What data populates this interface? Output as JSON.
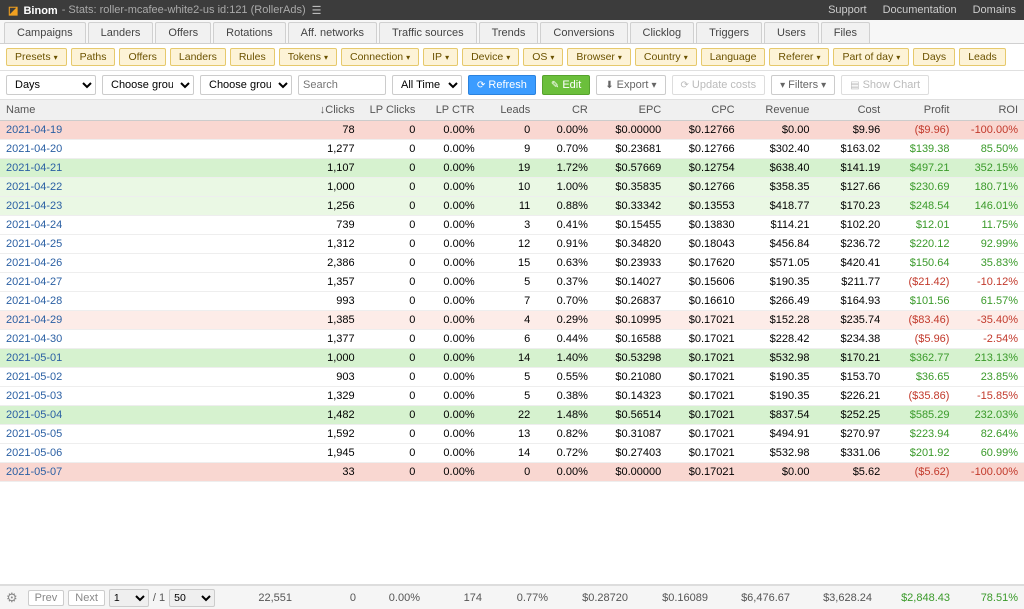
{
  "topbar": {
    "brand": "Binom",
    "title": "- Stats: roller-mcafee-white2-us id:121 (RollerAds)",
    "support": "Support",
    "documentation": "Documentation",
    "domains": "Domains"
  },
  "main_tabs": [
    "Campaigns",
    "Landers",
    "Offers",
    "Rotations",
    "Aff. networks",
    "Traffic sources",
    "Trends",
    "Conversions",
    "Clicklog",
    "Triggers",
    "Users",
    "Files"
  ],
  "pills": [
    {
      "label": "Presets",
      "caret": true
    },
    {
      "label": "Paths"
    },
    {
      "label": "Offers"
    },
    {
      "label": "Landers"
    },
    {
      "label": "Rules"
    },
    {
      "label": "Tokens",
      "caret": true
    },
    {
      "label": "Connection",
      "caret": true
    },
    {
      "label": "IP",
      "caret": true
    },
    {
      "label": "Device",
      "caret": true
    },
    {
      "label": "OS",
      "caret": true
    },
    {
      "label": "Browser",
      "caret": true
    },
    {
      "label": "Country",
      "caret": true
    },
    {
      "label": "Language"
    },
    {
      "label": "Referer",
      "caret": true
    },
    {
      "label": "Part of day",
      "caret": true
    },
    {
      "label": "Days"
    },
    {
      "label": "Leads"
    }
  ],
  "controls": {
    "group_days": "Days",
    "choose_grouping": "Choose grouping",
    "search_placeholder": "Search",
    "time_range": "All Time",
    "refresh": "Refresh",
    "edit": "Edit",
    "export": "Export",
    "update_costs": "Update costs",
    "filters": "Filters",
    "show_chart": "Show Chart"
  },
  "table": {
    "headers": {
      "name": "Name",
      "clicks": "Clicks",
      "clicks_sort": "↓",
      "lp_clicks": "LP Clicks",
      "lp_ctr": "LP CTR",
      "leads": "Leads",
      "cr": "CR",
      "epc": "EPC",
      "cpc": "CPC",
      "revenue": "Revenue",
      "cost": "Cost",
      "profit": "Profit",
      "roi": "ROI"
    },
    "rows": [
      {
        "name": "2021-04-19",
        "clicks": "78",
        "lp_clicks": "0",
        "lp_ctr": "0.00%",
        "leads": "0",
        "cr": "0.00%",
        "epc": "$0.00000",
        "cpc": "$0.12766",
        "revenue": "$0.00",
        "cost": "$9.96",
        "profit": "($9.96)",
        "roi": "-100.00%",
        "profit_neg": true,
        "roi_neg": true,
        "tone": "red"
      },
      {
        "name": "2021-04-20",
        "clicks": "1,277",
        "lp_clicks": "0",
        "lp_ctr": "0.00%",
        "leads": "9",
        "cr": "0.70%",
        "epc": "$0.23681",
        "cpc": "$0.12766",
        "revenue": "$302.40",
        "cost": "$163.02",
        "profit": "$139.38",
        "roi": "85.50%",
        "profit_neg": false,
        "roi_neg": false,
        "tone": ""
      },
      {
        "name": "2021-04-21",
        "clicks": "1,107",
        "lp_clicks": "0",
        "lp_ctr": "0.00%",
        "leads": "19",
        "cr": "1.72%",
        "epc": "$0.57669",
        "cpc": "$0.12754",
        "revenue": "$638.40",
        "cost": "$141.19",
        "profit": "$497.21",
        "roi": "352.15%",
        "profit_neg": false,
        "roi_neg": false,
        "tone": "green"
      },
      {
        "name": "2021-04-22",
        "clicks": "1,000",
        "lp_clicks": "0",
        "lp_ctr": "0.00%",
        "leads": "10",
        "cr": "1.00%",
        "epc": "$0.35835",
        "cpc": "$0.12766",
        "revenue": "$358.35",
        "cost": "$127.66",
        "profit": "$230.69",
        "roi": "180.71%",
        "profit_neg": false,
        "roi_neg": false,
        "tone": "ltgr"
      },
      {
        "name": "2021-04-23",
        "clicks": "1,256",
        "lp_clicks": "0",
        "lp_ctr": "0.00%",
        "leads": "11",
        "cr": "0.88%",
        "epc": "$0.33342",
        "cpc": "$0.13553",
        "revenue": "$418.77",
        "cost": "$170.23",
        "profit": "$248.54",
        "roi": "146.01%",
        "profit_neg": false,
        "roi_neg": false,
        "tone": "ltgr"
      },
      {
        "name": "2021-04-24",
        "clicks": "739",
        "lp_clicks": "0",
        "lp_ctr": "0.00%",
        "leads": "3",
        "cr": "0.41%",
        "epc": "$0.15455",
        "cpc": "$0.13830",
        "revenue": "$114.21",
        "cost": "$102.20",
        "profit": "$12.01",
        "roi": "11.75%",
        "profit_neg": false,
        "roi_neg": false,
        "tone": ""
      },
      {
        "name": "2021-04-25",
        "clicks": "1,312",
        "lp_clicks": "0",
        "lp_ctr": "0.00%",
        "leads": "12",
        "cr": "0.91%",
        "epc": "$0.34820",
        "cpc": "$0.18043",
        "revenue": "$456.84",
        "cost": "$236.72",
        "profit": "$220.12",
        "roi": "92.99%",
        "profit_neg": false,
        "roi_neg": false,
        "tone": ""
      },
      {
        "name": "2021-04-26",
        "clicks": "2,386",
        "lp_clicks": "0",
        "lp_ctr": "0.00%",
        "leads": "15",
        "cr": "0.63%",
        "epc": "$0.23933",
        "cpc": "$0.17620",
        "revenue": "$571.05",
        "cost": "$420.41",
        "profit": "$150.64",
        "roi": "35.83%",
        "profit_neg": false,
        "roi_neg": false,
        "tone": ""
      },
      {
        "name": "2021-04-27",
        "clicks": "1,357",
        "lp_clicks": "0",
        "lp_ctr": "0.00%",
        "leads": "5",
        "cr": "0.37%",
        "epc": "$0.14027",
        "cpc": "$0.15606",
        "revenue": "$190.35",
        "cost": "$211.77",
        "profit": "($21.42)",
        "roi": "-10.12%",
        "profit_neg": true,
        "roi_neg": true,
        "tone": ""
      },
      {
        "name": "2021-04-28",
        "clicks": "993",
        "lp_clicks": "0",
        "lp_ctr": "0.00%",
        "leads": "7",
        "cr": "0.70%",
        "epc": "$0.26837",
        "cpc": "$0.16610",
        "revenue": "$266.49",
        "cost": "$164.93",
        "profit": "$101.56",
        "roi": "61.57%",
        "profit_neg": false,
        "roi_neg": false,
        "tone": ""
      },
      {
        "name": "2021-04-29",
        "clicks": "1,385",
        "lp_clicks": "0",
        "lp_ctr": "0.00%",
        "leads": "4",
        "cr": "0.29%",
        "epc": "$0.10995",
        "cpc": "$0.17021",
        "revenue": "$152.28",
        "cost": "$235.74",
        "profit": "($83.46)",
        "roi": "-35.40%",
        "profit_neg": true,
        "roi_neg": true,
        "tone": "ltred"
      },
      {
        "name": "2021-04-30",
        "clicks": "1,377",
        "lp_clicks": "0",
        "lp_ctr": "0.00%",
        "leads": "6",
        "cr": "0.44%",
        "epc": "$0.16588",
        "cpc": "$0.17021",
        "revenue": "$228.42",
        "cost": "$234.38",
        "profit": "($5.96)",
        "roi": "-2.54%",
        "profit_neg": true,
        "roi_neg": true,
        "tone": ""
      },
      {
        "name": "2021-05-01",
        "clicks": "1,000",
        "lp_clicks": "0",
        "lp_ctr": "0.00%",
        "leads": "14",
        "cr": "1.40%",
        "epc": "$0.53298",
        "cpc": "$0.17021",
        "revenue": "$532.98",
        "cost": "$170.21",
        "profit": "$362.77",
        "roi": "213.13%",
        "profit_neg": false,
        "roi_neg": false,
        "tone": "green"
      },
      {
        "name": "2021-05-02",
        "clicks": "903",
        "lp_clicks": "0",
        "lp_ctr": "0.00%",
        "leads": "5",
        "cr": "0.55%",
        "epc": "$0.21080",
        "cpc": "$0.17021",
        "revenue": "$190.35",
        "cost": "$153.70",
        "profit": "$36.65",
        "roi": "23.85%",
        "profit_neg": false,
        "roi_neg": false,
        "tone": ""
      },
      {
        "name": "2021-05-03",
        "clicks": "1,329",
        "lp_clicks": "0",
        "lp_ctr": "0.00%",
        "leads": "5",
        "cr": "0.38%",
        "epc": "$0.14323",
        "cpc": "$0.17021",
        "revenue": "$190.35",
        "cost": "$226.21",
        "profit": "($35.86)",
        "roi": "-15.85%",
        "profit_neg": true,
        "roi_neg": true,
        "tone": ""
      },
      {
        "name": "2021-05-04",
        "clicks": "1,482",
        "lp_clicks": "0",
        "lp_ctr": "0.00%",
        "leads": "22",
        "cr": "1.48%",
        "epc": "$0.56514",
        "cpc": "$0.17021",
        "revenue": "$837.54",
        "cost": "$252.25",
        "profit": "$585.29",
        "roi": "232.03%",
        "profit_neg": false,
        "roi_neg": false,
        "tone": "green"
      },
      {
        "name": "2021-05-05",
        "clicks": "1,592",
        "lp_clicks": "0",
        "lp_ctr": "0.00%",
        "leads": "13",
        "cr": "0.82%",
        "epc": "$0.31087",
        "cpc": "$0.17021",
        "revenue": "$494.91",
        "cost": "$270.97",
        "profit": "$223.94",
        "roi": "82.64%",
        "profit_neg": false,
        "roi_neg": false,
        "tone": ""
      },
      {
        "name": "2021-05-06",
        "clicks": "1,945",
        "lp_clicks": "0",
        "lp_ctr": "0.00%",
        "leads": "14",
        "cr": "0.72%",
        "epc": "$0.27403",
        "cpc": "$0.17021",
        "revenue": "$532.98",
        "cost": "$331.06",
        "profit": "$201.92",
        "roi": "60.99%",
        "profit_neg": false,
        "roi_neg": false,
        "tone": ""
      },
      {
        "name": "2021-05-07",
        "clicks": "33",
        "lp_clicks": "0",
        "lp_ctr": "0.00%",
        "leads": "0",
        "cr": "0.00%",
        "epc": "$0.00000",
        "cpc": "$0.17021",
        "revenue": "$0.00",
        "cost": "$5.62",
        "profit": "($5.62)",
        "roi": "-100.00%",
        "profit_neg": true,
        "roi_neg": true,
        "tone": "red"
      }
    ]
  },
  "footer": {
    "prev": "Prev",
    "next": "Next",
    "page": "1",
    "pages_sep": "/ 1",
    "page_size": "50",
    "totals": {
      "clicks": "22,551",
      "lp_clicks": "0",
      "lp_ctr": "0.00%",
      "leads": "174",
      "cr": "0.77%",
      "epc": "$0.28720",
      "cpc": "$0.16089",
      "revenue": "$6,476.67",
      "cost": "$3,628.24",
      "profit": "$2,848.43",
      "roi": "78.51%"
    }
  }
}
